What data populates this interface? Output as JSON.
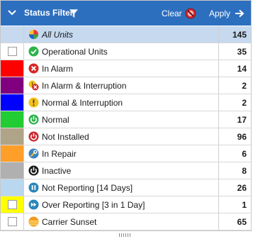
{
  "header": {
    "title": "Status Filter",
    "clear_label": "Clear",
    "apply_label": "Apply"
  },
  "rows": [
    {
      "label": "All Units",
      "count": "145",
      "icon": "all-units-icon",
      "swatch": ""
    },
    {
      "label": "Operational Units",
      "count": "35",
      "icon": "check-circle-icon",
      "swatch": ""
    },
    {
      "label": "In Alarm",
      "count": "14",
      "icon": "x-circle-icon",
      "swatch": "#ff0000"
    },
    {
      "label": "In Alarm & Interruption",
      "count": "2",
      "icon": "alarm-interruption-icon",
      "swatch": "#800080"
    },
    {
      "label": "Normal & Interruption",
      "count": "2",
      "icon": "exclamation-circle-icon",
      "swatch": "#0000ff"
    },
    {
      "label": "Normal",
      "count": "17",
      "icon": "power-green-icon",
      "swatch": "#22cc33"
    },
    {
      "label": "Not Installed",
      "count": "96",
      "icon": "power-red-icon",
      "swatch": "#b0a488"
    },
    {
      "label": "In Repair",
      "count": "6",
      "icon": "wrench-icon",
      "swatch": "#ff9f2a"
    },
    {
      "label": "Inactive",
      "count": "8",
      "icon": "power-black-icon",
      "swatch": "#b0b0b0"
    },
    {
      "label": "Not Reporting [14 Days]",
      "count": "26",
      "icon": "pause-circle-icon",
      "swatch": "#b9d7ee"
    },
    {
      "label": "Over Reporting [3 in 1 Day]",
      "count": "1",
      "icon": "fast-forward-circle-icon",
      "swatch": "#ffff00"
    },
    {
      "label": "Carrier Sunset",
      "count": "65",
      "icon": "sunset-icon",
      "swatch": ""
    }
  ]
}
